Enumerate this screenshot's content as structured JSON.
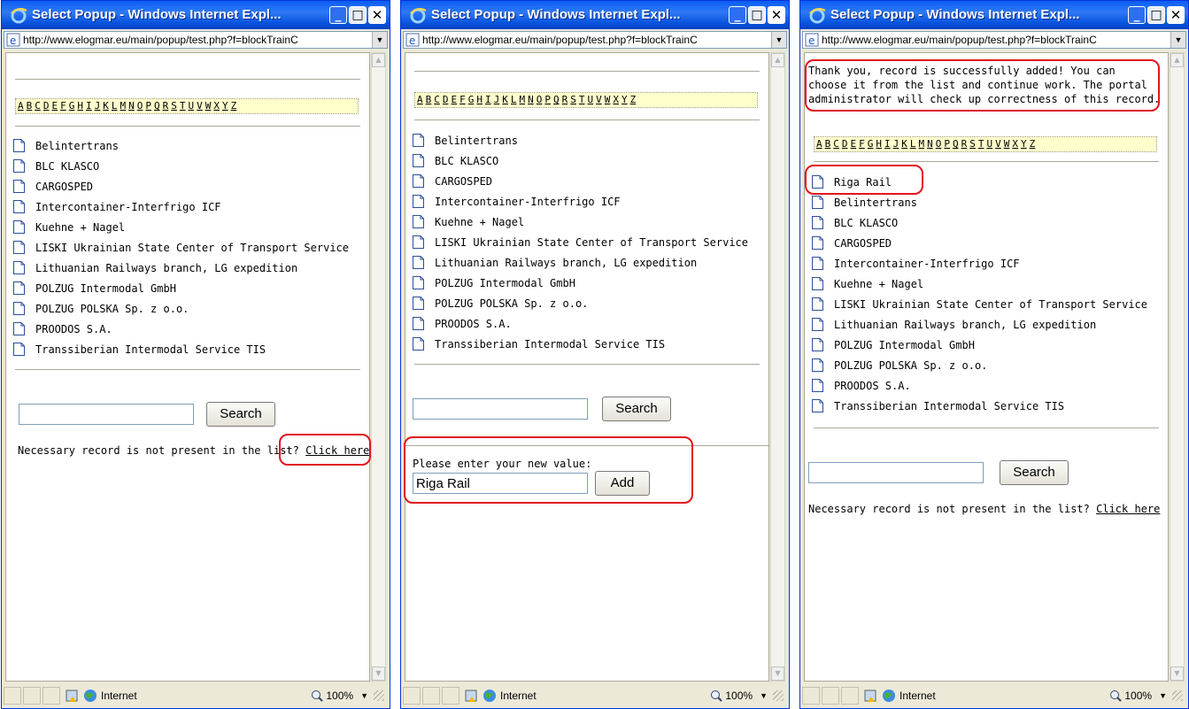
{
  "window": {
    "title": "Select Popup - Windows Internet Expl...",
    "url": "http://www.elogmar.eu/main/popup/test.php?f=blockTrainC",
    "status_zone": "Internet",
    "zoom": "100%"
  },
  "alphabet": [
    "A",
    "B",
    "C",
    "D",
    "E",
    "F",
    "G",
    "H",
    "I",
    "J",
    "K",
    "L",
    "M",
    "N",
    "O",
    "P",
    "Q",
    "R",
    "S",
    "T",
    "U",
    "V",
    "W",
    "X",
    "Y",
    "Z"
  ],
  "companies": [
    "Belintertrans",
    "BLC KLASCO",
    "CARGOSPED",
    "Intercontainer-Interfrigo ICF",
    "Kuehne + Nagel",
    "LISKI Ukrainian State Center of Transport Service",
    "Lithuanian Railways branch, LG expedition",
    "POLZUG Intermodal GmbH",
    "POLZUG POLSKA Sp. z o.o.",
    "PROODOS S.A.",
    "Transsiberian Intermodal Service TIS"
  ],
  "search": {
    "button_label": "Search",
    "input_value": ""
  },
  "not_present": {
    "text": "Necessary record is not present in the list?",
    "link": "Click here"
  },
  "add_form": {
    "prompt": "Please enter your new value:",
    "input_value": "Riga Rail",
    "button_label": "Add"
  },
  "success": {
    "lines": [
      "Thank you, record is successfully added! You can",
      "choose it from the list and continue work. The portal",
      "administrator will check up correctness of this record."
    ],
    "new_item": "Riga Rail"
  },
  "colors": {
    "title_bar": "#0a5ef5",
    "callout": "#e2141c",
    "alphabet_bg": "#ffffcc"
  },
  "icons": {
    "browser": "ie-logo-icon",
    "list_item": "document-icon",
    "zone": "globe-icon",
    "zoom": "magnifier-icon"
  }
}
